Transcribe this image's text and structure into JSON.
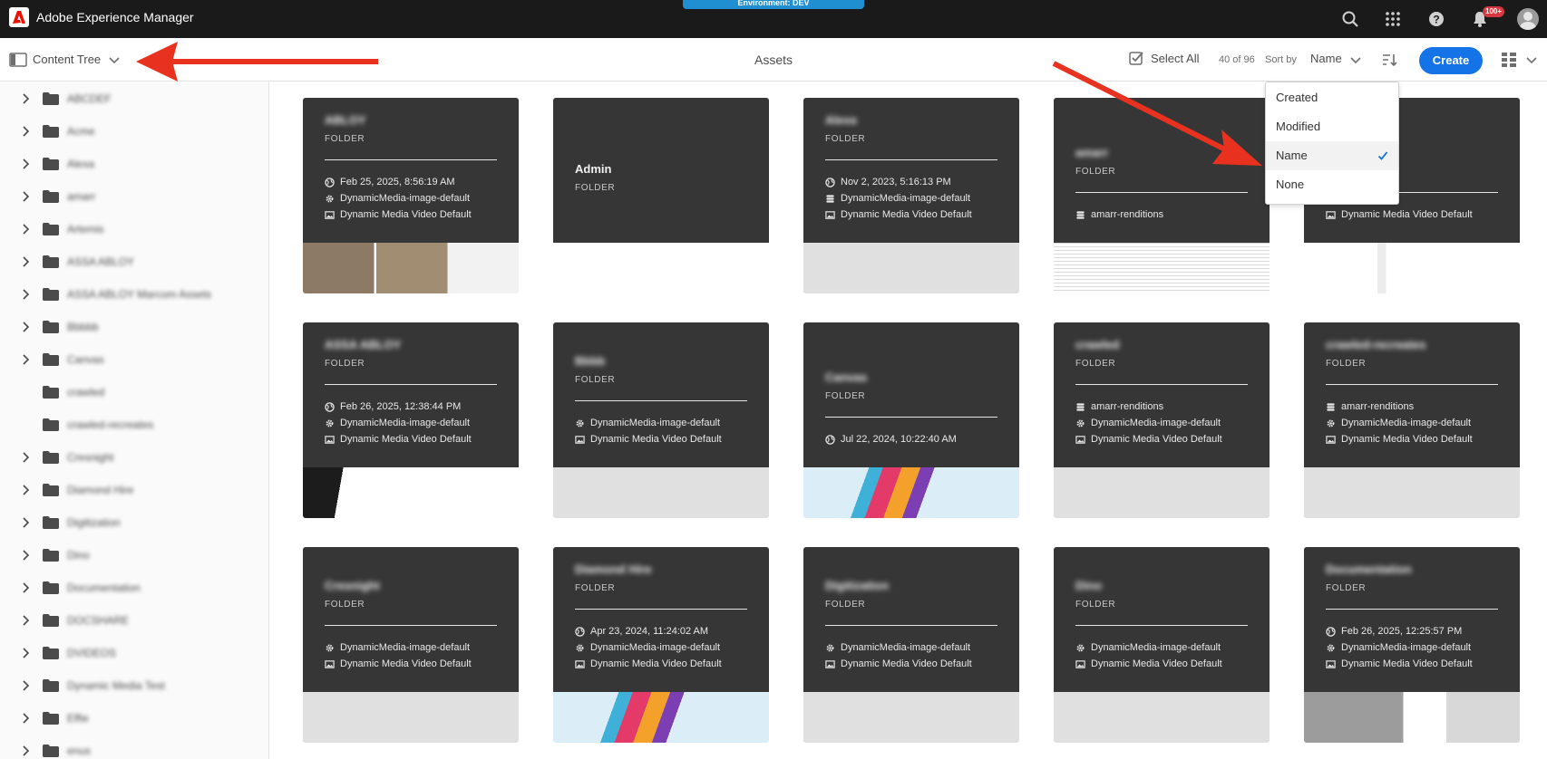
{
  "app": {
    "title": "Adobe Experience Manager",
    "environment": "Environment: DEV",
    "notification_count": "100+"
  },
  "toolbar": {
    "rail_label": "Content Tree",
    "page_title": "Assets",
    "select_all": "Select All",
    "count": "40 of 96",
    "sort_by_label": "Sort by",
    "sort_value": "Name",
    "create": "Create"
  },
  "sort_menu": {
    "options": [
      "Created",
      "Modified",
      "Name",
      "None"
    ],
    "selected": "Name"
  },
  "sidebar": {
    "items": [
      {
        "label": "ABCDEF",
        "expandable": true
      },
      {
        "label": "Acme",
        "expandable": true
      },
      {
        "label": "Alexa",
        "expandable": true
      },
      {
        "label": "amarr",
        "expandable": true
      },
      {
        "label": "Artemis",
        "expandable": true
      },
      {
        "label": "ASSA ABLOY",
        "expandable": true
      },
      {
        "label": "ASSA ABLOY Marcom Assets",
        "expandable": true
      },
      {
        "label": "Bbbbb",
        "expandable": true
      },
      {
        "label": "Canvas",
        "expandable": true
      },
      {
        "label": "crawled",
        "expandable": false
      },
      {
        "label": "crawled-recreates",
        "expandable": false
      },
      {
        "label": "Cresnight",
        "expandable": true
      },
      {
        "label": "Diamond Hire",
        "expandable": true
      },
      {
        "label": "Digitization",
        "expandable": true
      },
      {
        "label": "Dino",
        "expandable": true
      },
      {
        "label": "Documentation",
        "expandable": true
      },
      {
        "label": "DOCSHARE",
        "expandable": true
      },
      {
        "label": "DVIDEOS",
        "expandable": true
      },
      {
        "label": "Dynamic Media Test",
        "expandable": true
      },
      {
        "label": "Effie",
        "expandable": true
      },
      {
        "label": "enus",
        "expandable": true
      }
    ]
  },
  "cards": [
    {
      "name": "ABLOY",
      "blurred": true,
      "type": "FOLDER",
      "meta": [
        {
          "icon": "globe-icon",
          "text": "Feb 25, 2025, 8:56:19 AM"
        },
        {
          "icon": "gear-icon",
          "text": "DynamicMedia-image-default"
        },
        {
          "icon": "image-icon",
          "text": "Dynamic Media Video Default"
        }
      ]
    },
    {
      "name": "Admin",
      "blurred": false,
      "type": "FOLDER",
      "meta": []
    },
    {
      "name": "Alexa",
      "blurred": true,
      "type": "FOLDER",
      "meta": [
        {
          "icon": "globe-icon",
          "text": "Nov 2, 2023, 5:16:13 PM"
        },
        {
          "icon": "stack-icon",
          "text": "DynamicMedia-image-default"
        },
        {
          "icon": "image-icon",
          "text": "Dynamic Media Video Default"
        }
      ]
    },
    {
      "name": "amarr",
      "blurred": true,
      "type": "FOLDER",
      "meta": [
        {
          "icon": "stack-icon",
          "text": "amarr-renditions"
        }
      ]
    },
    {
      "name": "Artemis",
      "blurred": true,
      "type": "FOLDER",
      "meta": [
        {
          "icon": "image-icon",
          "text": "Dynamic Media Video Default"
        }
      ]
    },
    {
      "name": "ASSA ABLOY",
      "blurred": true,
      "type": "FOLDER",
      "meta": [
        {
          "icon": "globe-icon",
          "text": "Feb 26, 2025, 12:38:44 PM"
        },
        {
          "icon": "gear-icon",
          "text": "DynamicMedia-image-default"
        },
        {
          "icon": "image-icon",
          "text": "Dynamic Media Video Default"
        }
      ]
    },
    {
      "name": "Bbbb",
      "blurred": true,
      "type": "FOLDER",
      "meta": [
        {
          "icon": "gear-icon",
          "text": "DynamicMedia-image-default"
        },
        {
          "icon": "image-icon",
          "text": "Dynamic Media Video Default"
        }
      ]
    },
    {
      "name": "Canvas",
      "blurred": true,
      "type": "FOLDER",
      "meta": [
        {
          "icon": "globe-icon",
          "text": "Jul 22, 2024, 10:22:40 AM"
        }
      ]
    },
    {
      "name": "crawled",
      "blurred": true,
      "type": "FOLDER",
      "meta": [
        {
          "icon": "stack-icon",
          "text": "amarr-renditions"
        },
        {
          "icon": "gear-icon",
          "text": "DynamicMedia-image-default"
        },
        {
          "icon": "image-icon",
          "text": "Dynamic Media Video Default"
        }
      ]
    },
    {
      "name": "crawled-recreates",
      "blurred": true,
      "type": "FOLDER",
      "meta": [
        {
          "icon": "stack-icon",
          "text": "amarr-renditions"
        },
        {
          "icon": "gear-icon",
          "text": "DynamicMedia-image-default"
        },
        {
          "icon": "image-icon",
          "text": "Dynamic Media Video Default"
        }
      ]
    },
    {
      "name": "Cresnight",
      "blurred": true,
      "type": "FOLDER",
      "meta": [
        {
          "icon": "gear-icon",
          "text": "DynamicMedia-image-default"
        },
        {
          "icon": "image-icon",
          "text": "Dynamic Media Video Default"
        }
      ]
    },
    {
      "name": "Diamond Hire",
      "blurred": true,
      "type": "FOLDER",
      "meta": [
        {
          "icon": "globe-icon",
          "text": "Apr 23, 2024, 11:24:02 AM"
        },
        {
          "icon": "gear-icon",
          "text": "DynamicMedia-image-default"
        },
        {
          "icon": "image-icon",
          "text": "Dynamic Media Video Default"
        }
      ]
    },
    {
      "name": "Digitization",
      "blurred": true,
      "type": "FOLDER",
      "meta": [
        {
          "icon": "gear-icon",
          "text": "DynamicMedia-image-default"
        },
        {
          "icon": "image-icon",
          "text": "Dynamic Media Video Default"
        }
      ]
    },
    {
      "name": "Dino",
      "blurred": true,
      "type": "FOLDER",
      "meta": [
        {
          "icon": "gear-icon",
          "text": "DynamicMedia-image-default"
        },
        {
          "icon": "image-icon",
          "text": "Dynamic Media Video Default"
        }
      ]
    },
    {
      "name": "Documentation",
      "blurred": true,
      "type": "FOLDER",
      "meta": [
        {
          "icon": "globe-icon",
          "text": "Feb 26, 2025, 12:25:57 PM"
        },
        {
          "icon": "gear-icon",
          "text": "DynamicMedia-image-default"
        },
        {
          "icon": "image-icon",
          "text": "Dynamic Media Video Default"
        }
      ]
    }
  ],
  "colors": {
    "topbar": "#1a1a1a",
    "accent": "#1473e6",
    "environment_banner": "#1f8fd1",
    "annotation_arrow": "#e8321f"
  }
}
